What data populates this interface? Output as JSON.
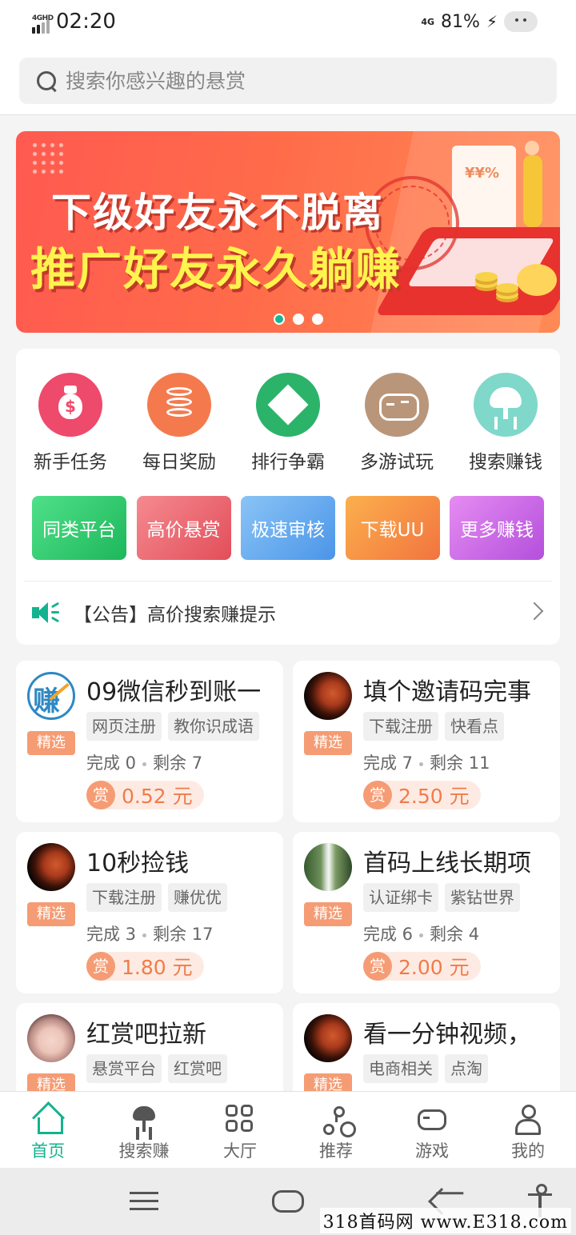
{
  "status_bar": {
    "network_left": "4GHD",
    "time": "02:20",
    "network_right": "4G",
    "battery": "81%"
  },
  "search": {
    "placeholder": "搜索你感兴趣的悬赏"
  },
  "banner": {
    "line1": "下级好友永不脱离",
    "line2": "推广好友永久躺赚",
    "paper_text": "¥¥%",
    "active_slide": 1,
    "slide_count": 3
  },
  "colors": {
    "accent": "#14b38f",
    "reward": "#f07c4a",
    "tag_pick": "#f59c74"
  },
  "quick_menu": [
    {
      "label": "新手任务",
      "icon": "money-bag-icon",
      "color": "#ee4a6b"
    },
    {
      "label": "每日奖励",
      "icon": "coin-stack-icon",
      "color": "#f47a4e"
    },
    {
      "label": "排行争霸",
      "icon": "diamond-icon",
      "color": "#2bb36a"
    },
    {
      "label": "多游试玩",
      "icon": "gamepad-icon",
      "color": "#b9967a"
    },
    {
      "label": "搜索赚钱",
      "icon": "tree-icon",
      "color": "#7fd8c9"
    }
  ],
  "feature_buttons": [
    {
      "label": "同类平台",
      "gradient": [
        "#4fe08a",
        "#1eb75a"
      ]
    },
    {
      "label": "高价悬赏",
      "gradient": [
        "#f58a8f",
        "#e24e5a"
      ]
    },
    {
      "label": "极速审核",
      "gradient": [
        "#8ac4f6",
        "#4b95e8"
      ]
    },
    {
      "label": "下载UU",
      "gradient": [
        "#fbb04d",
        "#f2743f"
      ]
    },
    {
      "label": "更多赚钱",
      "gradient": [
        "#e58cf2",
        "#b44fdc"
      ]
    }
  ],
  "notice": {
    "text": "【公告】高价搜索赚提示"
  },
  "task_cards": [
    {
      "title": "09微信秒到账一",
      "tags": [
        "网页注册",
        "教你识成语"
      ],
      "badge": "精选",
      "done": "完成 0",
      "left": "剩余 7",
      "reward_icon": "赏",
      "reward": "0.52 元",
      "avatar_text": "赚"
    },
    {
      "title": "填个邀请码完事",
      "tags": [
        "下载注册",
        "快看点"
      ],
      "badge": "精选",
      "done": "完成 7",
      "left": "剩余 11",
      "reward_icon": "赏",
      "reward": "2.50 元"
    },
    {
      "title": "10秒捡钱",
      "tags": [
        "下载注册",
        "赚优优"
      ],
      "badge": "精选",
      "done": "完成 3",
      "left": "剩余 17",
      "reward_icon": "赏",
      "reward": "1.80 元"
    },
    {
      "title": "首码上线长期项",
      "tags": [
        "认证绑卡",
        "紫钻世界"
      ],
      "badge": "精选",
      "done": "完成 6",
      "left": "剩余 4",
      "reward_icon": "赏",
      "reward": "2.00 元"
    },
    {
      "title": "红赏吧拉新",
      "tags": [
        "悬赏平台",
        "红赏吧"
      ],
      "badge": "精选"
    },
    {
      "title": "看一分钟视频，",
      "tags": [
        "电商相关",
        "点淘"
      ],
      "badge": "精选"
    }
  ],
  "tabs": [
    {
      "label": "首页",
      "active": true
    },
    {
      "label": "搜索赚"
    },
    {
      "label": "大厅"
    },
    {
      "label": "推荐"
    },
    {
      "label": "游戏"
    },
    {
      "label": "我的"
    }
  ],
  "watermark": "318首码网 www.E318.com"
}
